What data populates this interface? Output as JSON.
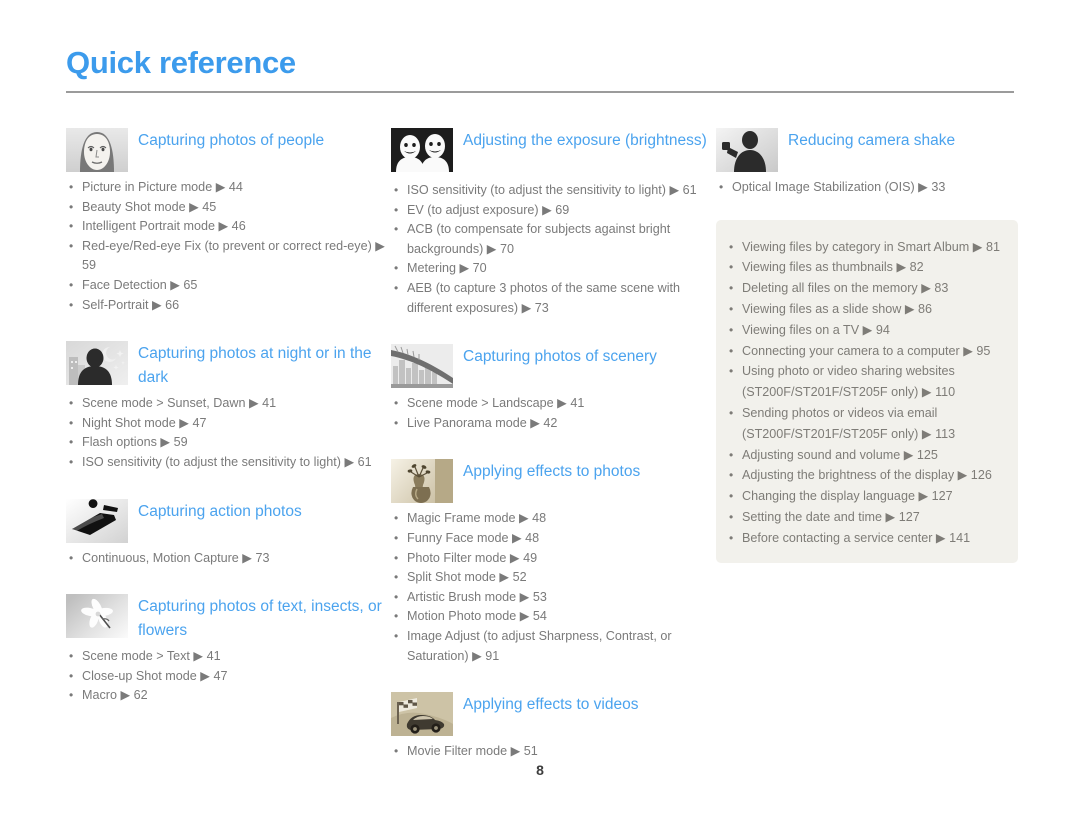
{
  "header": {
    "title": "Quick reference"
  },
  "footer": {
    "page_number": "8"
  },
  "colors": {
    "accent": "#4ba3ee",
    "title": "#3c9bec",
    "body_text": "#7a7a7a",
    "rule": "#9b9b9b",
    "box_background": "#f2f1ec"
  },
  "columns": [
    {
      "sections": [
        {
          "icon": "portrait-face-icon",
          "title": "Capturing photos of people",
          "items": [
            "Picture in Picture mode ▶ 44",
            "Beauty Shot mode ▶ 45",
            "Intelligent Portrait mode ▶ 46",
            "Red-eye/Red-eye Fix (to prevent or correct red-eye) ▶ 59",
            "Face Detection ▶ 65",
            "Self-Portrait ▶ 66"
          ]
        },
        {
          "icon": "night-scene-icon",
          "title": "Capturing photos at night or in the dark",
          "items": [
            "Scene mode > Sunset, Dawn ▶ 41",
            "Night Shot mode ▶ 47",
            "Flash options ▶ 59",
            "ISO sensitivity (to adjust the sensitivity to light) ▶ 61"
          ]
        },
        {
          "icon": "snowboarder-action-icon",
          "title": "Capturing action photos",
          "items": [
            "Continuous, Motion Capture ▶ 73"
          ]
        },
        {
          "icon": "flower-macro-icon",
          "title": "Capturing photos of text, insects, or flowers",
          "items": [
            "Scene mode > Text ▶ 41",
            "Close-up Shot mode ▶ 47",
            "Macro ▶ 62"
          ]
        }
      ]
    },
    {
      "sections": [
        {
          "icon": "two-faces-exposure-icon",
          "title": "Adjusting the exposure (brightness)",
          "items": [
            "ISO sensitivity (to adjust the sensitivity to light) ▶ 61",
            "EV (to adjust exposure) ▶ 69",
            "ACB (to compensate for subjects against bright backgrounds) ▶ 70",
            "Metering ▶ 70",
            "AEB (to capture 3 photos of the same scene with different exposures) ▶ 73"
          ]
        },
        {
          "icon": "bridge-scenery-icon",
          "title": "Capturing photos of scenery",
          "items": [
            "Scene mode > Landscape ▶ 41",
            "Live Panorama mode ▶ 42"
          ]
        },
        {
          "icon": "vase-effects-icon",
          "title": "Applying effects to photos",
          "items": [
            "Magic Frame mode ▶ 48",
            "Funny Face mode ▶ 48",
            "Photo Filter mode ▶ 49",
            "Split Shot mode ▶ 52",
            "Artistic Brush mode ▶ 53",
            "Motion Photo mode ▶ 54",
            "Image Adjust (to adjust Sharpness, Contrast, or Saturation) ▶ 91"
          ]
        },
        {
          "icon": "race-car-video-icon",
          "title": "Applying effects to videos",
          "items": [
            "Movie Filter mode ▶ 51"
          ]
        }
      ]
    },
    {
      "sections": [
        {
          "icon": "camera-shake-person-icon",
          "title": "Reducing camera shake",
          "items": [
            "Optical Image Stabilization (OIS) ▶ 33"
          ]
        }
      ],
      "info_box": {
        "items": [
          "Viewing files by category in Smart Album ▶ 81",
          "Viewing files as thumbnails ▶ 82",
          "Deleting all files on the memory ▶ 83",
          "Viewing files as a slide show ▶ 86",
          "Viewing files on a TV ▶ 94",
          "Connecting your camera to a computer ▶ 95",
          "Using photo or video sharing websites (ST200F/ST201F/ST205F only) ▶ 110",
          "Sending photos or videos via email (ST200F/ST201F/ST205F only) ▶ 113",
          "Adjusting sound and volume ▶ 125",
          "Adjusting the brightness of the display ▶ 126",
          "Changing the display language ▶ 127",
          "Setting the date and time ▶ 127",
          "Before contacting a service center ▶ 141"
        ]
      }
    }
  ]
}
